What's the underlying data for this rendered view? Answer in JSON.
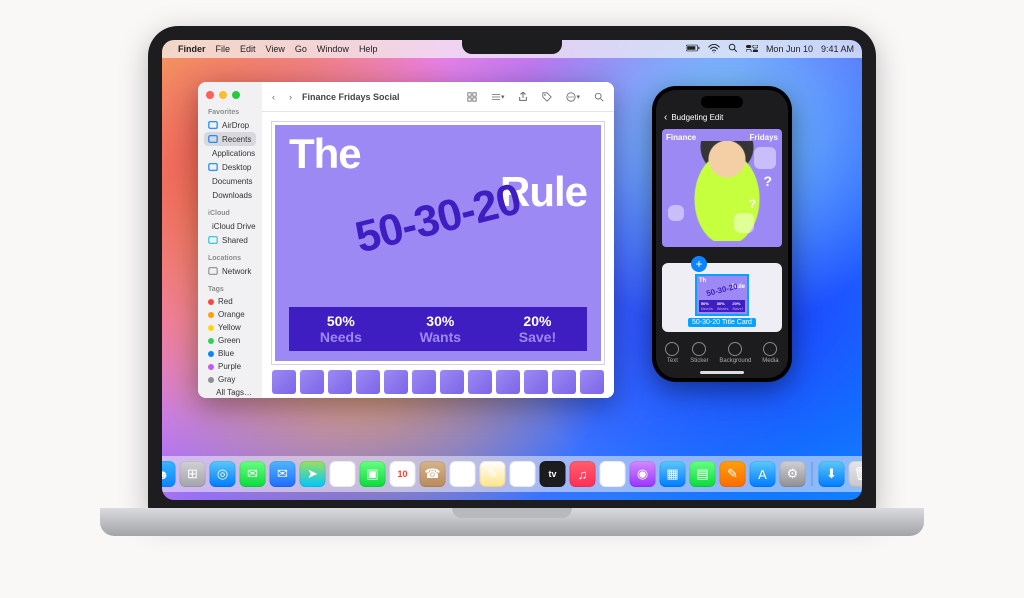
{
  "menubar": {
    "app": "Finder",
    "items": [
      "File",
      "Edit",
      "View",
      "Go",
      "Window",
      "Help"
    ],
    "date": "Mon Jun 10",
    "time": "9:41 AM"
  },
  "finder": {
    "title": "Finance Fridays Social",
    "sidebar": {
      "favorites_title": "Favorites",
      "favorites": [
        {
          "label": "AirDrop",
          "color": "#0a84ff"
        },
        {
          "label": "Recents",
          "color": "#0a84ff",
          "selected": true
        },
        {
          "label": "Applications",
          "color": "#0a84ff"
        },
        {
          "label": "Desktop",
          "color": "#0a84ff"
        },
        {
          "label": "Documents",
          "color": "#0a84ff"
        },
        {
          "label": "Downloads",
          "color": "#0a84ff"
        }
      ],
      "icloud_title": "iCloud",
      "icloud": [
        {
          "label": "iCloud Drive",
          "color": "#1fc5de"
        },
        {
          "label": "Shared",
          "color": "#1fc5de"
        }
      ],
      "locations_title": "Locations",
      "locations": [
        {
          "label": "Network",
          "color": "#8e8e93"
        }
      ],
      "tags_title": "Tags",
      "tags": [
        {
          "label": "Red",
          "color": "#ff453a"
        },
        {
          "label": "Orange",
          "color": "#ff9f0a"
        },
        {
          "label": "Yellow",
          "color": "#ffd60a"
        },
        {
          "label": "Green",
          "color": "#30d158"
        },
        {
          "label": "Blue",
          "color": "#0a84ff"
        },
        {
          "label": "Purple",
          "color": "#bf5af2"
        },
        {
          "label": "Gray",
          "color": "#8e8e93"
        },
        {
          "label": "All Tags…",
          "color": "transparent"
        }
      ]
    },
    "hero": {
      "line1": "The",
      "diag": "50-30-20",
      "line2": "Rule",
      "rules": [
        {
          "pct": "50%",
          "lbl": "Needs"
        },
        {
          "pct": "30%",
          "lbl": "Wants"
        },
        {
          "pct": "20%",
          "lbl": "Save!"
        }
      ]
    },
    "thumbs": 12
  },
  "phone": {
    "header_back": "‹",
    "header_title": "Budgeting Edit",
    "banner_left": "Finance",
    "banner_right": "Fridays",
    "mini": {
      "line1": "Th",
      "diag": "50-30-20",
      "line2": "Rule",
      "bar": [
        {
          "a": "50%",
          "b": "Needs"
        },
        {
          "a": "30%",
          "b": "Wants"
        },
        {
          "a": "20%",
          "b": "Save!"
        }
      ],
      "label": "50-30-20 Title Card"
    },
    "tabs": [
      "Text",
      "Sticker",
      "Background",
      "Media"
    ]
  },
  "dock": {
    "apps": [
      {
        "name": "finder",
        "bg": "linear-gradient(#38b6ff,#0a84ff)",
        "glyph": "☻"
      },
      {
        "name": "launchpad",
        "bg": "linear-gradient(#d0d0d5,#a3a3aa)",
        "glyph": "⊞"
      },
      {
        "name": "safari",
        "bg": "linear-gradient(#5ac8fa,#007aff)",
        "glyph": "◎"
      },
      {
        "name": "messages",
        "bg": "linear-gradient(#67ff81,#0bda3c)",
        "glyph": "✉"
      },
      {
        "name": "mail",
        "bg": "linear-gradient(#4fb7ff,#1f6bff)",
        "glyph": "✉"
      },
      {
        "name": "maps",
        "bg": "linear-gradient(#9be15d,#00c6ff)",
        "glyph": "➤"
      },
      {
        "name": "photos",
        "bg": "#fff",
        "glyph": "✿"
      },
      {
        "name": "facetime",
        "bg": "linear-gradient(#67ff81,#0bda3c)",
        "glyph": "▣"
      },
      {
        "name": "calendar",
        "bg": "#fff",
        "glyph": "10"
      },
      {
        "name": "contacts",
        "bg": "linear-gradient(#d6b48a,#b98a5b)",
        "glyph": "☎"
      },
      {
        "name": "reminders",
        "bg": "#fff",
        "glyph": "☰"
      },
      {
        "name": "notes",
        "bg": "linear-gradient(#fff,#ffe58a)",
        "glyph": "✎"
      },
      {
        "name": "freeform",
        "bg": "#fff",
        "glyph": "✏"
      },
      {
        "name": "tv",
        "bg": "#1c1c1e",
        "glyph": "tv"
      },
      {
        "name": "music",
        "bg": "linear-gradient(#ff5e6e,#ff2d55)",
        "glyph": "♫"
      },
      {
        "name": "news",
        "bg": "#fff",
        "glyph": "N"
      },
      {
        "name": "podcasts",
        "bg": "linear-gradient(#d28bff,#9a34ff)",
        "glyph": "◉"
      },
      {
        "name": "keynote",
        "bg": "linear-gradient(#5ac8fa,#007aff)",
        "glyph": "▦"
      },
      {
        "name": "numbers",
        "bg": "linear-gradient(#67ff81,#0bda3c)",
        "glyph": "▤"
      },
      {
        "name": "pages",
        "bg": "linear-gradient(#ff9f0a,#ff6b00)",
        "glyph": "✎"
      },
      {
        "name": "appstore",
        "bg": "linear-gradient(#5ac8fa,#007aff)",
        "glyph": "A"
      },
      {
        "name": "settings",
        "bg": "linear-gradient(#d0d0d5,#8e8e93)",
        "glyph": "⚙"
      }
    ],
    "tray": [
      {
        "name": "downloads",
        "bg": "linear-gradient(#5ac8fa,#007aff)",
        "glyph": "⬇"
      },
      {
        "name": "trash",
        "bg": "linear-gradient(#e5e5ea,#c7c7cc)",
        "glyph": "🗑"
      }
    ]
  }
}
